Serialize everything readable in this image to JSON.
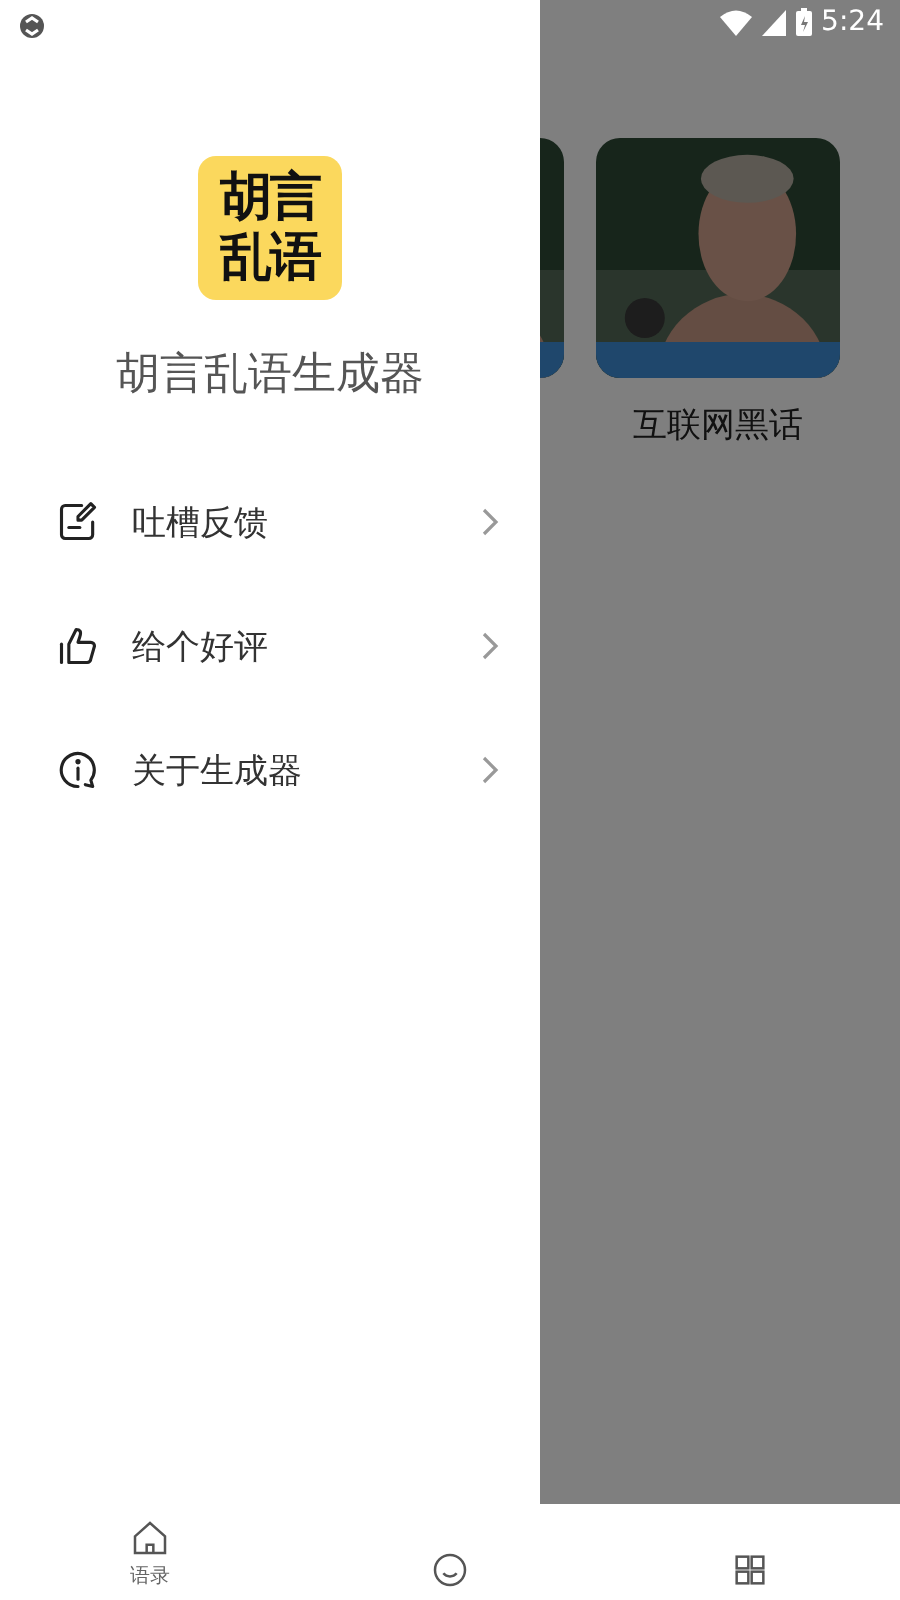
{
  "status_bar": {
    "time": "5:24"
  },
  "cards": [
    {
      "kind": "partial"
    },
    {
      "kind": "full",
      "caption": "互联网黑话"
    }
  ],
  "drawer": {
    "logo_lines": [
      "胡言",
      "乱语"
    ],
    "app_name": "胡言乱语生成器",
    "menu": [
      {
        "kind": "feedback",
        "label": "吐槽反馈"
      },
      {
        "kind": "thumb",
        "label": "给个好评"
      },
      {
        "kind": "info",
        "label": "关于生成器"
      }
    ]
  },
  "bottom_nav": [
    {
      "kind": "home",
      "label": "语录"
    },
    {
      "kind": "smile"
    },
    {
      "kind": "tool"
    }
  ]
}
